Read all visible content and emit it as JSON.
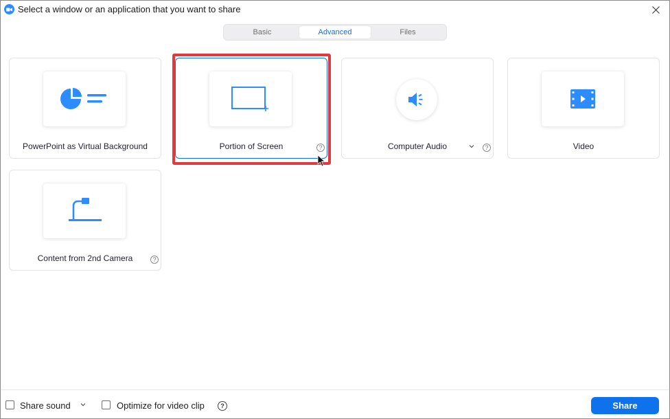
{
  "window": {
    "title": "Select a window or an application that you want to share",
    "app_icon": "zoom-logo-icon",
    "close_icon": "close-icon"
  },
  "tabs": [
    {
      "label": "Basic",
      "active": false
    },
    {
      "label": "Advanced",
      "active": true
    },
    {
      "label": "Files",
      "active": false
    }
  ],
  "options": [
    {
      "label": "PowerPoint as Virtual Background",
      "icon": "pie-chart-icon",
      "help": false,
      "selected": false
    },
    {
      "label": "Portion of Screen",
      "icon": "screen-portion-icon",
      "help": true,
      "selected": true
    },
    {
      "label": "Computer Audio",
      "icon": "speaker-icon",
      "help": true,
      "dropdown": true,
      "selected": false
    },
    {
      "label": "Video",
      "icon": "film-play-icon",
      "help": false,
      "selected": false
    },
    {
      "label": "Content from 2nd Camera",
      "icon": "document-camera-icon",
      "help": true,
      "selected": false
    }
  ],
  "help_glyph": "?",
  "bottom": {
    "share_sound_label": "Share sound",
    "share_sound_checked": false,
    "optimize_label": "Optimize for video clip",
    "optimize_checked": false,
    "share_button": "Share"
  },
  "colors": {
    "accent": "#0e72ed",
    "icon_blue": "#2d8cff",
    "highlight_red": "#e0393e"
  }
}
